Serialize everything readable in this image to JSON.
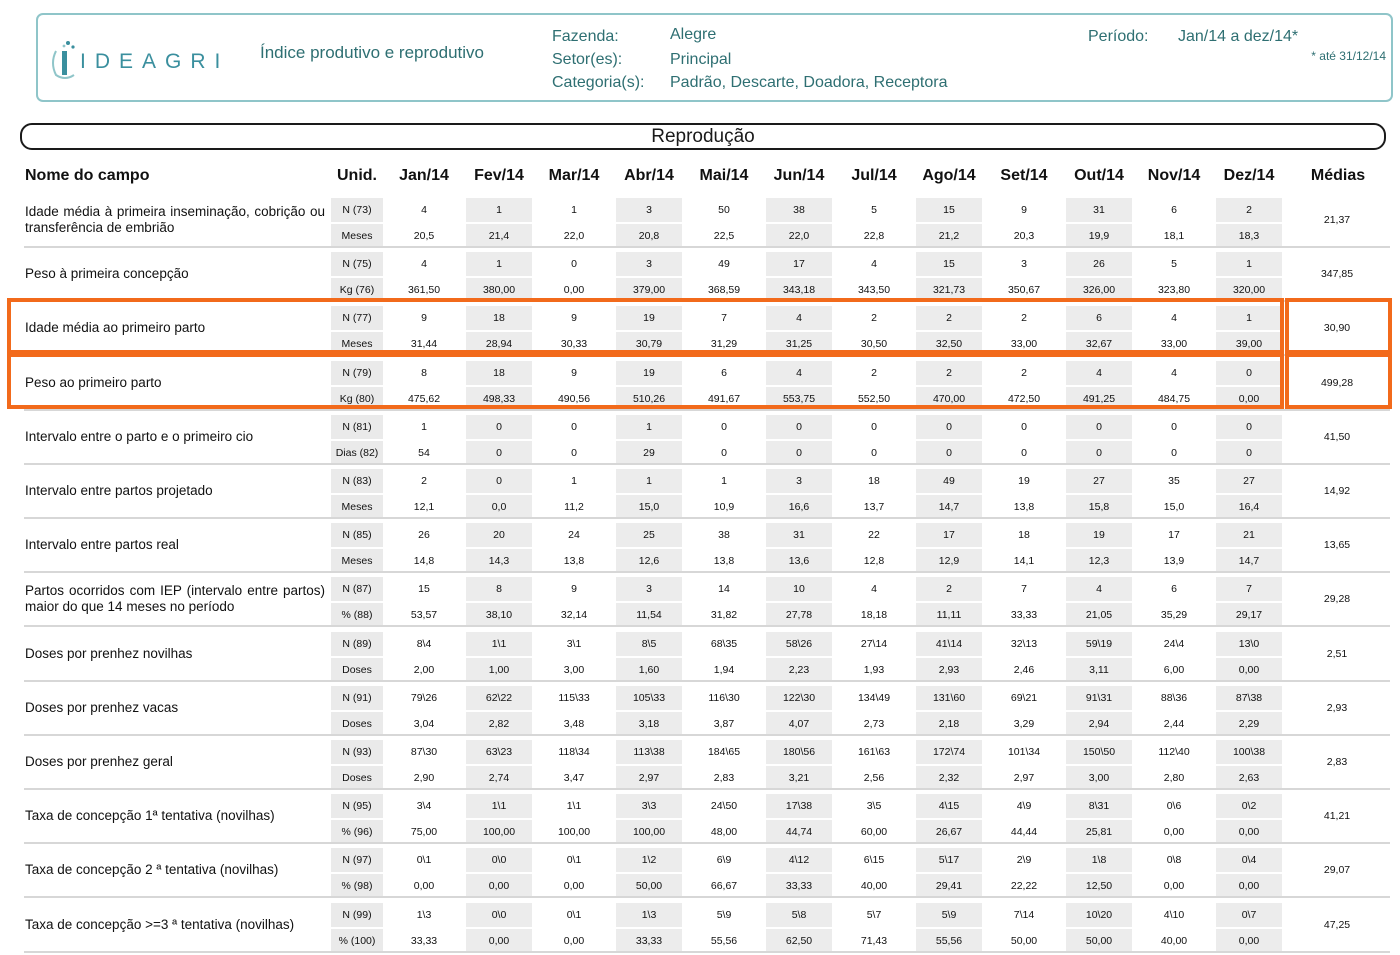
{
  "header": {
    "logo_text": "IDEAGRI",
    "title": "Índice produtivo e reprodutivo",
    "farm_label": "Fazenda:",
    "farm_value": "Alegre",
    "sector_label": "Setor(es):",
    "sector_value": "Principal",
    "category_label": "Categoria(s):",
    "category_value": "Padrão, Descarte, Doadora, Receptora",
    "period_label": "Período:",
    "period_value": "Jan/14 a dez/14*",
    "period_note": "* até 31/12/14"
  },
  "section_title": "Reprodução",
  "columns": {
    "field": "Nome do campo",
    "unit": "Unid.",
    "months": [
      "Jan/14",
      "Fev/14",
      "Mar/14",
      "Abr/14",
      "Mai/14",
      "Jun/14",
      "Jul/14",
      "Ago/14",
      "Set/14",
      "Out/14",
      "Nov/14",
      "Dez/14"
    ],
    "avg": "Médias"
  },
  "rows": [
    {
      "name": "Idade média à primeira inseminação, cobrição ou transferência de embrião",
      "u1": "N (73)",
      "u2": "Meses",
      "v1": [
        "4",
        "1",
        "1",
        "3",
        "50",
        "38",
        "5",
        "15",
        "9",
        "31",
        "6",
        "2"
      ],
      "v2": [
        "20,5",
        "21,4",
        "22,0",
        "20,8",
        "22,5",
        "22,0",
        "22,8",
        "21,2",
        "20,3",
        "19,9",
        "18,1",
        "18,3"
      ],
      "avg": "21,37"
    },
    {
      "name": "Peso à primeira concepção",
      "u1": "N (75)",
      "u2": "Kg (76)",
      "v1": [
        "4",
        "1",
        "0",
        "3",
        "49",
        "17",
        "4",
        "15",
        "3",
        "26",
        "5",
        "1"
      ],
      "v2": [
        "361,50",
        "380,00",
        "0,00",
        "379,00",
        "368,59",
        "343,18",
        "343,50",
        "321,73",
        "350,67",
        "326,00",
        "323,80",
        "320,00"
      ],
      "avg": "347,85"
    },
    {
      "name": "Idade média ao primeiro parto",
      "u1": "N (77)",
      "u2": "Meses",
      "v1": [
        "9",
        "18",
        "9",
        "19",
        "7",
        "4",
        "2",
        "2",
        "2",
        "6",
        "4",
        "1"
      ],
      "v2": [
        "31,44",
        "28,94",
        "30,33",
        "30,79",
        "31,29",
        "31,25",
        "30,50",
        "32,50",
        "33,00",
        "32,67",
        "33,00",
        "39,00"
      ],
      "avg": "30,90"
    },
    {
      "name": "Peso ao primeiro parto",
      "u1": "N (79)",
      "u2": "Kg (80)",
      "v1": [
        "8",
        "18",
        "9",
        "19",
        "6",
        "4",
        "2",
        "2",
        "2",
        "4",
        "4",
        "0"
      ],
      "v2": [
        "475,62",
        "498,33",
        "490,56",
        "510,26",
        "491,67",
        "553,75",
        "552,50",
        "470,00",
        "472,50",
        "491,25",
        "484,75",
        "0,00"
      ],
      "avg": "499,28"
    },
    {
      "name": "Intervalo entre o parto e o primeiro cio",
      "u1": "N (81)",
      "u2": "Dias (82)",
      "v1": [
        "1",
        "0",
        "0",
        "1",
        "0",
        "0",
        "0",
        "0",
        "0",
        "0",
        "0",
        "0"
      ],
      "v2": [
        "54",
        "0",
        "0",
        "29",
        "0",
        "0",
        "0",
        "0",
        "0",
        "0",
        "0",
        "0"
      ],
      "avg": "41,50"
    },
    {
      "name": "Intervalo entre partos projetado",
      "u1": "N (83)",
      "u2": "Meses",
      "v1": [
        "2",
        "0",
        "1",
        "1",
        "1",
        "3",
        "18",
        "49",
        "19",
        "27",
        "35",
        "27"
      ],
      "v2": [
        "12,1",
        "0,0",
        "11,2",
        "15,0",
        "10,9",
        "16,6",
        "13,7",
        "14,7",
        "13,8",
        "15,8",
        "15,0",
        "16,4"
      ],
      "avg": "14,92"
    },
    {
      "name": "Intervalo entre partos real",
      "u1": "N (85)",
      "u2": "Meses",
      "v1": [
        "26",
        "20",
        "24",
        "25",
        "38",
        "31",
        "22",
        "17",
        "18",
        "19",
        "17",
        "21"
      ],
      "v2": [
        "14,8",
        "14,3",
        "13,8",
        "12,6",
        "13,8",
        "13,6",
        "12,8",
        "12,9",
        "14,1",
        "12,3",
        "13,9",
        "14,7"
      ],
      "avg": "13,65"
    },
    {
      "name": "Partos ocorridos com IEP (intervalo entre partos) maior do que 14 meses no período",
      "u1": "N (87)",
      "u2": "% (88)",
      "v1": [
        "15",
        "8",
        "9",
        "3",
        "14",
        "10",
        "4",
        "2",
        "7",
        "4",
        "6",
        "7"
      ],
      "v2": [
        "53,57",
        "38,10",
        "32,14",
        "11,54",
        "31,82",
        "27,78",
        "18,18",
        "11,11",
        "33,33",
        "21,05",
        "35,29",
        "29,17"
      ],
      "avg": "29,28"
    },
    {
      "name": "Doses por prenhez novilhas",
      "u1": "N (89)",
      "u2": "Doses",
      "v1": [
        "8\\4",
        "1\\1",
        "3\\1",
        "8\\5",
        "68\\35",
        "58\\26",
        "27\\14",
        "41\\14",
        "32\\13",
        "59\\19",
        "24\\4",
        "13\\0"
      ],
      "v2": [
        "2,00",
        "1,00",
        "3,00",
        "1,60",
        "1,94",
        "2,23",
        "1,93",
        "2,93",
        "2,46",
        "3,11",
        "6,00",
        "0,00"
      ],
      "avg": "2,51"
    },
    {
      "name": "Doses por prenhez vacas",
      "u1": "N (91)",
      "u2": "Doses",
      "v1": [
        "79\\26",
        "62\\22",
        "115\\33",
        "105\\33",
        "116\\30",
        "122\\30",
        "134\\49",
        "131\\60",
        "69\\21",
        "91\\31",
        "88\\36",
        "87\\38"
      ],
      "v2": [
        "3,04",
        "2,82",
        "3,48",
        "3,18",
        "3,87",
        "4,07",
        "2,73",
        "2,18",
        "3,29",
        "2,94",
        "2,44",
        "2,29"
      ],
      "avg": "2,93"
    },
    {
      "name": "Doses por prenhez geral",
      "u1": "N (93)",
      "u2": "Doses",
      "v1": [
        "87\\30",
        "63\\23",
        "118\\34",
        "113\\38",
        "184\\65",
        "180\\56",
        "161\\63",
        "172\\74",
        "101\\34",
        "150\\50",
        "112\\40",
        "100\\38"
      ],
      "v2": [
        "2,90",
        "2,74",
        "3,47",
        "2,97",
        "2,83",
        "3,21",
        "2,56",
        "2,32",
        "2,97",
        "3,00",
        "2,80",
        "2,63"
      ],
      "avg": "2,83"
    },
    {
      "name": "Taxa de concepção 1ª tentativa (novilhas)",
      "u1": "N (95)",
      "u2": "% (96)",
      "v1": [
        "3\\4",
        "1\\1",
        "1\\1",
        "3\\3",
        "24\\50",
        "17\\38",
        "3\\5",
        "4\\15",
        "4\\9",
        "8\\31",
        "0\\6",
        "0\\2"
      ],
      "v2": [
        "75,00",
        "100,00",
        "100,00",
        "100,00",
        "48,00",
        "44,74",
        "60,00",
        "26,67",
        "44,44",
        "25,81",
        "0,00",
        "0,00"
      ],
      "avg": "41,21"
    },
    {
      "name": "Taxa de concepção 2 ª tentativa (novilhas)",
      "u1": "N (97)",
      "u2": "% (98)",
      "v1": [
        "0\\1",
        "0\\0",
        "0\\1",
        "1\\2",
        "6\\9",
        "4\\12",
        "6\\15",
        "5\\17",
        "2\\9",
        "1\\8",
        "0\\8",
        "0\\4"
      ],
      "v2": [
        "0,00",
        "0,00",
        "0,00",
        "50,00",
        "66,67",
        "33,33",
        "40,00",
        "29,41",
        "22,22",
        "12,50",
        "0,00",
        "0,00"
      ],
      "avg": "29,07"
    },
    {
      "name": "Taxa de concepção >=3 ª tentativa (novilhas)",
      "u1": "N (99)",
      "u2": "% (100)",
      "v1": [
        "1\\3",
        "0\\0",
        "0\\1",
        "1\\3",
        "5\\9",
        "5\\8",
        "5\\7",
        "5\\9",
        "7\\14",
        "10\\20",
        "4\\10",
        "0\\7"
      ],
      "v2": [
        "33,33",
        "0,00",
        "0,00",
        "33,33",
        "55,56",
        "62,50",
        "71,43",
        "55,56",
        "50,00",
        "50,00",
        "40,00",
        "0,00"
      ],
      "avg": "47,25"
    }
  ],
  "highlight_color": "#f26a1b"
}
